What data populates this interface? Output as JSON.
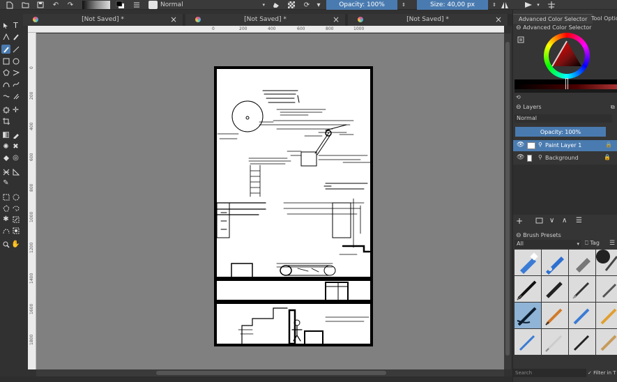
{
  "toolbar": {
    "blend_mode": "Normal",
    "opacity": "Opacity: 100%",
    "size": "Size: 40,00 px"
  },
  "tabs": [
    {
      "title": "[Not Saved]  *"
    },
    {
      "title": "[Not Saved]  *"
    },
    {
      "title": "[Not Saved]  *"
    }
  ],
  "ruler": {
    "top": [
      "0",
      "200",
      "400",
      "600",
      "800",
      "1000"
    ],
    "left": [
      "0",
      "200",
      "400",
      "600",
      "800",
      "1000",
      "1200",
      "1400",
      "1600",
      "1800"
    ]
  },
  "docker": {
    "tabs": [
      "Advanced Color Selector",
      "Tool Optio"
    ],
    "color_selector_title": "Advanced Color Selector",
    "layers_title": "Layers",
    "layers_blend": "Normal",
    "layers_opacity": "Opacity:  100%",
    "layers": [
      {
        "name": "Paint Layer 1",
        "selected": true
      },
      {
        "name": "Background",
        "selected": false
      }
    ],
    "brush_presets_title": "Brush Presets",
    "brush_filter": "All",
    "tag_label": "Tag",
    "search_placeholder": "Search",
    "filter_label": "Filter in T"
  },
  "colors": {
    "accent": "#4a7bb0",
    "panel": "#353535",
    "canvas_bg": "#808080"
  }
}
